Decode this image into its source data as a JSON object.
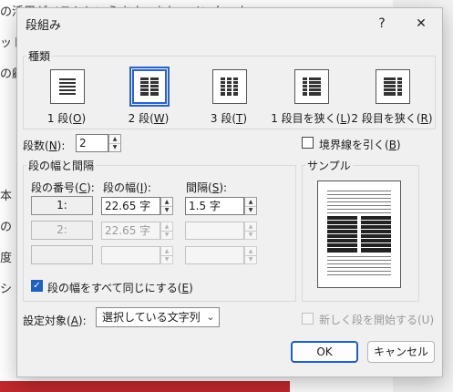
{
  "background": {
    "lines": [
      "の活用がベストといえます。また、インターネ",
      "ット",
      "の顧",
      "本",
      "の",
      "度",
      "シ"
    ]
  },
  "dialog": {
    "title": "段組み",
    "help_label": "?",
    "close_label": "✕"
  },
  "presets": {
    "group_label": "種類",
    "items": [
      {
        "label": "1 段(",
        "key": "O",
        "close": ")"
      },
      {
        "label": "2 段(",
        "key": "W",
        "close": ")"
      },
      {
        "label": "3 段(",
        "key": "T",
        "close": ")"
      },
      {
        "label": "1 段目を狭く(",
        "key": "L",
        "close": ")"
      },
      {
        "label": "2 段目を狭く(",
        "key": "R",
        "close": ")"
      }
    ],
    "selected_index": 1
  },
  "columns": {
    "label": "段数(",
    "key": "N",
    "close": "):",
    "value": "2"
  },
  "line_between": {
    "label": "境界線を引く(",
    "key": "B",
    "close": ")",
    "checked": false
  },
  "width_spacing": {
    "group_label": "段の幅と間隔",
    "col_header": "段の番号(",
    "col_key": "C",
    "col_close": "):",
    "width_header": "段の幅(",
    "width_key": "I",
    "width_close": "):",
    "spacing_header": "間隔(",
    "spacing_key": "S",
    "spacing_close": "):",
    "rows": [
      {
        "number": "1:",
        "width": "22.65 字",
        "spacing": "1.5 字",
        "enabled": true
      },
      {
        "number": "2:",
        "width": "22.65 字",
        "spacing": "",
        "enabled": false
      },
      {
        "number": "",
        "width": "",
        "spacing": "",
        "enabled": false
      }
    ]
  },
  "equal_width": {
    "label": "段の幅をすべて同じにする(",
    "key": "E",
    "close": ")",
    "checked": true
  },
  "sample": {
    "group_label": "サンプル"
  },
  "apply_to": {
    "label": "設定対象(",
    "key": "A",
    "close": "):",
    "value": "選択している文字列"
  },
  "new_column": {
    "label": "新しく段を開始する(U)",
    "checked": false
  },
  "buttons": {
    "ok": "OK",
    "cancel": "キャンセル"
  },
  "colors": {
    "accent": "#1f5fbf",
    "background_bar": "#c0282d"
  }
}
